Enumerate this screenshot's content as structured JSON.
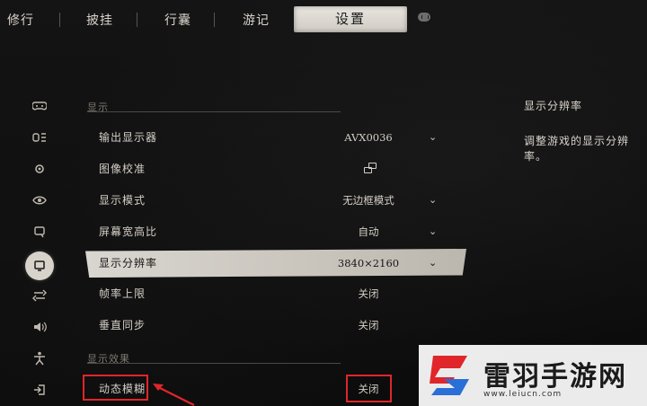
{
  "tabs": {
    "t1": "修行",
    "t2": "披挂",
    "t3": "行囊",
    "t4": "游记",
    "active": "设置",
    "next_icon": "rb-button-icon"
  },
  "sidebar": {
    "icons": [
      "gamepad-icon",
      "keyboard-icon",
      "gear-icon",
      "eye-icon",
      "chat-icon",
      "display-icon",
      "adjust-icon",
      "speaker-icon",
      "accessibility-icon",
      "exit-icon"
    ],
    "active_index": 5
  },
  "sections": {
    "display": "显示",
    "effects": "显示效果"
  },
  "settings": {
    "output_monitor": {
      "label": "输出显示器",
      "value": "AVX0036"
    },
    "calibration": {
      "label": "图像校准",
      "icon": "copy-icon"
    },
    "display_mode": {
      "label": "显示模式",
      "value": "无边框模式"
    },
    "aspect_ratio": {
      "label": "屏幕宽高比",
      "value": "自动"
    },
    "resolution": {
      "label": "显示分辨率",
      "value": "3840×2160"
    },
    "frame_limit": {
      "label": "帧率上限",
      "value": "关闭"
    },
    "vsync": {
      "label": "垂直同步",
      "value": "关闭"
    },
    "motion_blur": {
      "label": "动态模糊",
      "value": "关闭"
    }
  },
  "info": {
    "title": "显示分辨率",
    "description": "调整游戏的显示分辨率。"
  },
  "watermark": {
    "name": "雷羽手游网",
    "url": "www.leiucn.com"
  },
  "colors": {
    "highlight": "#e0262a",
    "active_tab": "#e9e6e0",
    "background": "#0b0b0b"
  }
}
